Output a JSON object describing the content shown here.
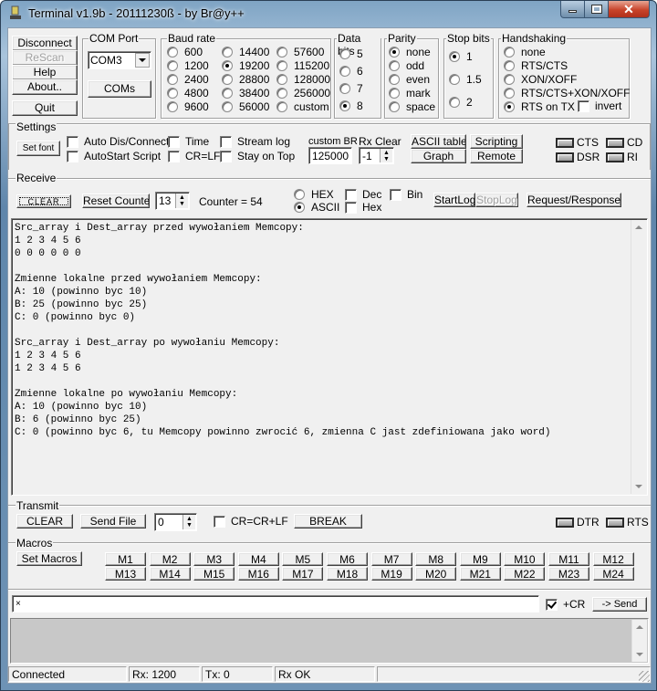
{
  "window": {
    "title": "Terminal v1.9b - 20111230ß - by Br@y++",
    "controls": {
      "minimize": "—",
      "maximize": "□",
      "close": "✕"
    }
  },
  "left_buttons": {
    "disconnect": "Disconnect",
    "rescan": "ReScan",
    "help": "Help",
    "about": "About..",
    "quit": "Quit"
  },
  "com_port": {
    "label": "COM Port",
    "selected": "COM3",
    "coms_button": "COMs"
  },
  "baud_rate": {
    "label": "Baud rate",
    "options": [
      "600",
      "1200",
      "2400",
      "4800",
      "9600",
      "14400",
      "19200",
      "28800",
      "38400",
      "56000",
      "57600",
      "115200",
      "128000",
      "256000",
      "custom"
    ],
    "selected": "19200"
  },
  "data_bits": {
    "label": "Data bits",
    "options": [
      "5",
      "6",
      "7",
      "8"
    ],
    "selected": "8"
  },
  "parity": {
    "label": "Parity",
    "options": [
      "none",
      "odd",
      "even",
      "mark",
      "space"
    ],
    "selected": "none"
  },
  "stop_bits": {
    "label": "Stop bits",
    "options": [
      "1",
      "1.5",
      "2"
    ],
    "selected": "1"
  },
  "handshaking": {
    "label": "Handshaking",
    "options": [
      "none",
      "RTS/CTS",
      "XON/XOFF",
      "RTS/CTS+XON/XOFF",
      "RTS on TX"
    ],
    "selected": "RTS on TX",
    "invert_label": "invert",
    "invert_checked": false
  },
  "settings": {
    "label": "Settings",
    "set_font": "Set font",
    "checkboxes": [
      {
        "label": "Auto Dis/Connect",
        "checked": false
      },
      {
        "label": "AutoStart Script",
        "checked": false
      },
      {
        "label": "Time",
        "checked": false
      },
      {
        "label": "CR=LF",
        "checked": false
      },
      {
        "label": "Stream log",
        "checked": false
      },
      {
        "label": "Stay on Top",
        "checked": false
      }
    ],
    "custom_br_label": "custom BR",
    "custom_br_value": "125000",
    "rx_clear_label": "Rx Clear",
    "rx_clear_value": "-1",
    "ascii_table": "ASCII table",
    "graph": "Graph",
    "scripting": "Scripting",
    "remote": "Remote",
    "leds": [
      "CTS",
      "CD",
      "DSR",
      "RI"
    ]
  },
  "receive": {
    "label": "Receive",
    "clear_button": "CLEAR",
    "reset_counter": "Reset Counter",
    "counter_spin": "13",
    "counter_text": "Counter =  54",
    "modes": [
      "HEX",
      "ASCII"
    ],
    "mode_selected": "ASCII",
    "dec_label": "Dec",
    "bin_label": "Bin",
    "hex_label": "Hex",
    "start_log": "StartLog",
    "stop_log": "StopLog",
    "request_response": "Request/Response",
    "output_lines": [
      "Src_array i Dest_array przed wywołaniem Memcopy:",
      "1 2 3 4 5 6",
      "0 0 0 0 0 0",
      "",
      "Zmienne lokalne przed wywołaniem Memcopy:",
      "A: 10 (powinno byc 10)",
      "B: 25 (powinno byc 25)",
      "C: 0 (powinno byc 0)",
      "",
      "Src_array i Dest_array po wywołaniu Memcopy:",
      "1 2 3 4 5 6",
      "1 2 3 4 5 6",
      "",
      "Zmienne lokalne po wywołaniu Memcopy:",
      "A: 10 (powinno byc 10)",
      "B: 6 (powinno byc 25)",
      "C: 0 (powinno byc 6, tu Memcopy powinno zwrocić 6, zmienna C jast zdefiniowana jako word)"
    ]
  },
  "transmit": {
    "label": "Transmit",
    "clear": "CLEAR",
    "send_file": "Send File",
    "spin_value": "0",
    "cr_crlf_label": "CR=CR+LF",
    "cr_crlf_checked": false,
    "break": "BREAK",
    "leds": [
      "DTR",
      "RTS"
    ]
  },
  "macros": {
    "label": "Macros",
    "set_macros": "Set Macros",
    "buttons": [
      "M1",
      "M2",
      "M3",
      "M4",
      "M5",
      "M6",
      "M7",
      "M8",
      "M9",
      "M10",
      "M11",
      "M12",
      "M13",
      "M14",
      "M15",
      "M16",
      "M17",
      "M18",
      "M19",
      "M20",
      "M21",
      "M22",
      "M23",
      "M24"
    ]
  },
  "send_line": {
    "input_value": "×",
    "plus_cr_label": "+CR",
    "plus_cr_checked": true,
    "send_button": "-> Send"
  },
  "status_bar": {
    "connection": "Connected",
    "rx": "Rx: 1200",
    "tx": "Tx: 0",
    "rx_status": "Rx OK"
  }
}
